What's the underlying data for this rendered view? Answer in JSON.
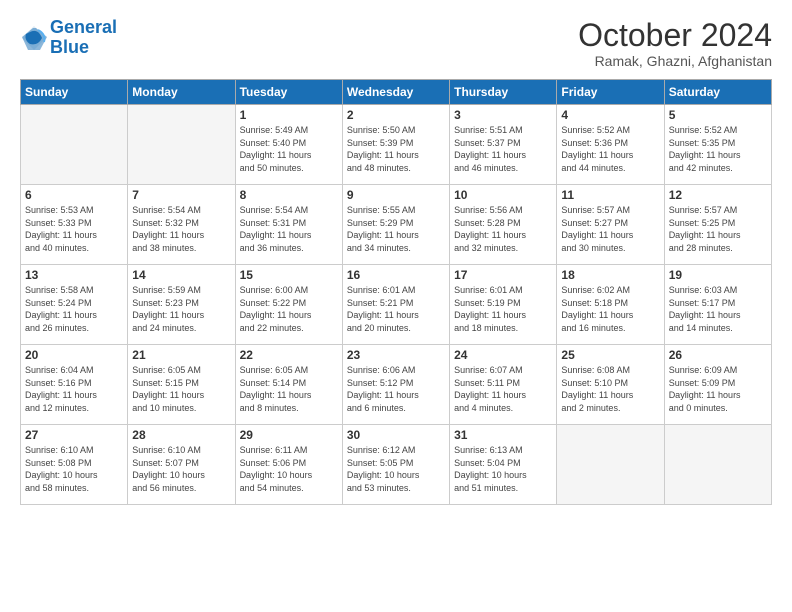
{
  "header": {
    "logo_line1": "General",
    "logo_line2": "Blue",
    "month_title": "October 2024",
    "location": "Ramak, Ghazni, Afghanistan"
  },
  "days_of_week": [
    "Sunday",
    "Monday",
    "Tuesday",
    "Wednesday",
    "Thursday",
    "Friday",
    "Saturday"
  ],
  "weeks": [
    [
      {
        "num": "",
        "info": ""
      },
      {
        "num": "",
        "info": ""
      },
      {
        "num": "1",
        "info": "Sunrise: 5:49 AM\nSunset: 5:40 PM\nDaylight: 11 hours\nand 50 minutes."
      },
      {
        "num": "2",
        "info": "Sunrise: 5:50 AM\nSunset: 5:39 PM\nDaylight: 11 hours\nand 48 minutes."
      },
      {
        "num": "3",
        "info": "Sunrise: 5:51 AM\nSunset: 5:37 PM\nDaylight: 11 hours\nand 46 minutes."
      },
      {
        "num": "4",
        "info": "Sunrise: 5:52 AM\nSunset: 5:36 PM\nDaylight: 11 hours\nand 44 minutes."
      },
      {
        "num": "5",
        "info": "Sunrise: 5:52 AM\nSunset: 5:35 PM\nDaylight: 11 hours\nand 42 minutes."
      }
    ],
    [
      {
        "num": "6",
        "info": "Sunrise: 5:53 AM\nSunset: 5:33 PM\nDaylight: 11 hours\nand 40 minutes."
      },
      {
        "num": "7",
        "info": "Sunrise: 5:54 AM\nSunset: 5:32 PM\nDaylight: 11 hours\nand 38 minutes."
      },
      {
        "num": "8",
        "info": "Sunrise: 5:54 AM\nSunset: 5:31 PM\nDaylight: 11 hours\nand 36 minutes."
      },
      {
        "num": "9",
        "info": "Sunrise: 5:55 AM\nSunset: 5:29 PM\nDaylight: 11 hours\nand 34 minutes."
      },
      {
        "num": "10",
        "info": "Sunrise: 5:56 AM\nSunset: 5:28 PM\nDaylight: 11 hours\nand 32 minutes."
      },
      {
        "num": "11",
        "info": "Sunrise: 5:57 AM\nSunset: 5:27 PM\nDaylight: 11 hours\nand 30 minutes."
      },
      {
        "num": "12",
        "info": "Sunrise: 5:57 AM\nSunset: 5:25 PM\nDaylight: 11 hours\nand 28 minutes."
      }
    ],
    [
      {
        "num": "13",
        "info": "Sunrise: 5:58 AM\nSunset: 5:24 PM\nDaylight: 11 hours\nand 26 minutes."
      },
      {
        "num": "14",
        "info": "Sunrise: 5:59 AM\nSunset: 5:23 PM\nDaylight: 11 hours\nand 24 minutes."
      },
      {
        "num": "15",
        "info": "Sunrise: 6:00 AM\nSunset: 5:22 PM\nDaylight: 11 hours\nand 22 minutes."
      },
      {
        "num": "16",
        "info": "Sunrise: 6:01 AM\nSunset: 5:21 PM\nDaylight: 11 hours\nand 20 minutes."
      },
      {
        "num": "17",
        "info": "Sunrise: 6:01 AM\nSunset: 5:19 PM\nDaylight: 11 hours\nand 18 minutes."
      },
      {
        "num": "18",
        "info": "Sunrise: 6:02 AM\nSunset: 5:18 PM\nDaylight: 11 hours\nand 16 minutes."
      },
      {
        "num": "19",
        "info": "Sunrise: 6:03 AM\nSunset: 5:17 PM\nDaylight: 11 hours\nand 14 minutes."
      }
    ],
    [
      {
        "num": "20",
        "info": "Sunrise: 6:04 AM\nSunset: 5:16 PM\nDaylight: 11 hours\nand 12 minutes."
      },
      {
        "num": "21",
        "info": "Sunrise: 6:05 AM\nSunset: 5:15 PM\nDaylight: 11 hours\nand 10 minutes."
      },
      {
        "num": "22",
        "info": "Sunrise: 6:05 AM\nSunset: 5:14 PM\nDaylight: 11 hours\nand 8 minutes."
      },
      {
        "num": "23",
        "info": "Sunrise: 6:06 AM\nSunset: 5:12 PM\nDaylight: 11 hours\nand 6 minutes."
      },
      {
        "num": "24",
        "info": "Sunrise: 6:07 AM\nSunset: 5:11 PM\nDaylight: 11 hours\nand 4 minutes."
      },
      {
        "num": "25",
        "info": "Sunrise: 6:08 AM\nSunset: 5:10 PM\nDaylight: 11 hours\nand 2 minutes."
      },
      {
        "num": "26",
        "info": "Sunrise: 6:09 AM\nSunset: 5:09 PM\nDaylight: 11 hours\nand 0 minutes."
      }
    ],
    [
      {
        "num": "27",
        "info": "Sunrise: 6:10 AM\nSunset: 5:08 PM\nDaylight: 10 hours\nand 58 minutes."
      },
      {
        "num": "28",
        "info": "Sunrise: 6:10 AM\nSunset: 5:07 PM\nDaylight: 10 hours\nand 56 minutes."
      },
      {
        "num": "29",
        "info": "Sunrise: 6:11 AM\nSunset: 5:06 PM\nDaylight: 10 hours\nand 54 minutes."
      },
      {
        "num": "30",
        "info": "Sunrise: 6:12 AM\nSunset: 5:05 PM\nDaylight: 10 hours\nand 53 minutes."
      },
      {
        "num": "31",
        "info": "Sunrise: 6:13 AM\nSunset: 5:04 PM\nDaylight: 10 hours\nand 51 minutes."
      },
      {
        "num": "",
        "info": ""
      },
      {
        "num": "",
        "info": ""
      }
    ]
  ]
}
